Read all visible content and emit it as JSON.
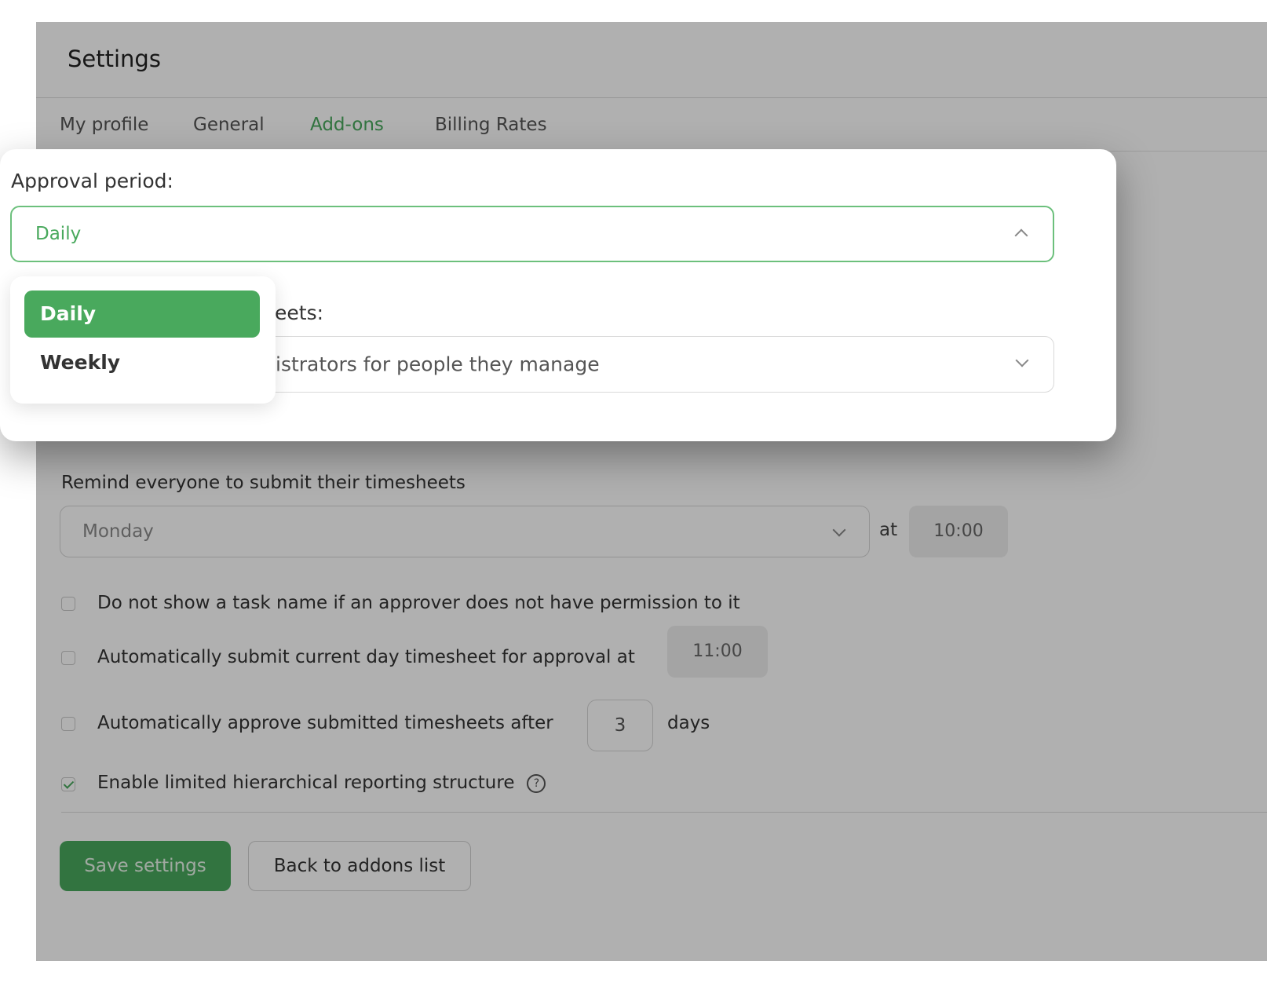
{
  "header": {
    "title": "Settings"
  },
  "tabs": [
    {
      "label": "My profile"
    },
    {
      "label": "General"
    },
    {
      "label": "Add-ons"
    },
    {
      "label": "Billing Rates"
    }
  ],
  "popover": {
    "approval_label": "Approval period:",
    "approval_value": "Daily",
    "second_label_partial": "eets:",
    "second_value_partial": "istrators for people they manage",
    "options": [
      "Daily",
      "Weekly"
    ]
  },
  "reminder": {
    "label": "Remind everyone to submit their timesheets",
    "day": "Monday",
    "at_label": "at",
    "time": "10:00"
  },
  "options": {
    "hide_task_name": {
      "label": "Do not show a task name if an approver does not have permission to it",
      "checked": false
    },
    "auto_submit": {
      "label": "Automatically submit current day timesheet for approval at",
      "time": "11:00",
      "checked": false
    },
    "auto_approve": {
      "label": "Automatically approve submitted timesheets after",
      "days": "3",
      "unit": "days",
      "checked": false
    },
    "hierarchy": {
      "label": "Enable limited hierarchical reporting structure",
      "help": "?",
      "checked": true
    }
  },
  "buttons": {
    "save": "Save settings",
    "back": "Back to addons list"
  },
  "colors": {
    "accent": "#49a95d"
  }
}
